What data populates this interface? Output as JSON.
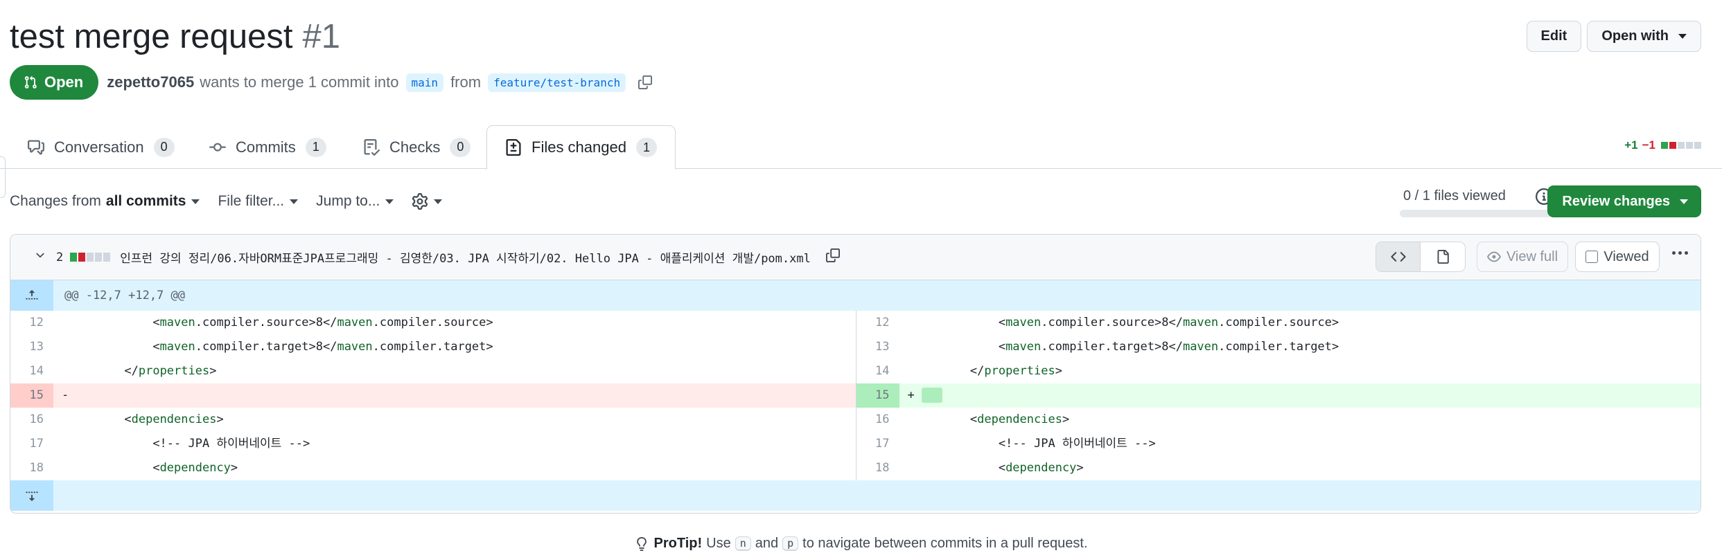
{
  "pr": {
    "title": "test merge request",
    "number": "#1",
    "state": "Open",
    "author": "zepetto7065",
    "merge_text": "wants to merge 1 commit into",
    "base_branch": "main",
    "from_text": "from",
    "head_branch": "feature/test-branch"
  },
  "header_actions": {
    "edit": "Edit",
    "open_with": "Open with"
  },
  "tabs": [
    {
      "label": "Conversation",
      "count": "0",
      "icon": "comment-discussion-icon"
    },
    {
      "label": "Commits",
      "count": "1",
      "icon": "git-commit-icon"
    },
    {
      "label": "Checks",
      "count": "0",
      "icon": "checklist-icon"
    },
    {
      "label": "Files changed",
      "count": "1",
      "icon": "file-diff-icon",
      "active": true
    }
  ],
  "diffstat": {
    "additions": "+1",
    "deletions": "−1"
  },
  "toolbar": {
    "changes_from": "Changes from",
    "changes_from_value": "all commits",
    "file_filter": "File filter...",
    "jump_to": "Jump to...",
    "files_viewed": "0 / 1 files viewed",
    "files_viewed_progress": 0,
    "review_changes": "Review changes"
  },
  "file": {
    "change_count": "2",
    "path": "인프런 강의 정리/06.자바ORM표준JPA프로그래밍 - 김영한/03. JPA 시작하기/02. Hello JPA - 애플리케이션 개발/pom.xml",
    "view_full": "View full",
    "viewed_label": "Viewed",
    "hunk_header": "@@ -12,7 +12,7 @@",
    "rows": [
      {
        "l_num": "12",
        "l_indent": "        ",
        "l_pre": "<",
        "l_tag": "maven",
        "l_post": ".compiler.source>8</",
        "l_tag2": "maven",
        "l_post2": ".compiler.source>",
        "r_num": "12",
        "r_indent": "        ",
        "r_pre": "<",
        "r_tag": "maven",
        "r_post": ".compiler.source>8</",
        "r_tag2": "maven",
        "r_post2": ".compiler.source>"
      },
      {
        "l_num": "13",
        "l_indent": "        ",
        "l_pre": "<",
        "l_tag": "maven",
        "l_post": ".compiler.target>8</",
        "l_tag2": "maven",
        "l_post2": ".compiler.target>",
        "r_num": "13",
        "r_indent": "        ",
        "r_pre": "<",
        "r_tag": "maven",
        "r_post": ".compiler.target>8</",
        "r_tag2": "maven",
        "r_post2": ".compiler.target>"
      },
      {
        "l_num": "14",
        "l_indent": "    ",
        "l_pre": "</",
        "l_tag": "properties",
        "l_post": ">",
        "l_tag2": "",
        "l_post2": "",
        "r_num": "14",
        "r_indent": "    ",
        "r_pre": "</",
        "r_tag": "properties",
        "r_post": ">",
        "r_tag2": "",
        "r_post2": ""
      },
      {
        "l_num": "15",
        "l_marker": "-",
        "r_num": "15",
        "r_marker": "+",
        "kind": "change"
      },
      {
        "l_num": "16",
        "l_indent": "    ",
        "l_pre": "<",
        "l_tag": "dependencies",
        "l_post": ">",
        "l_tag2": "",
        "l_post2": "",
        "r_num": "16",
        "r_indent": "    ",
        "r_pre": "<",
        "r_tag": "dependencies",
        "r_post": ">",
        "r_tag2": "",
        "r_post2": ""
      },
      {
        "l_num": "17",
        "l_indent": "        ",
        "l_pre": "<!-- JPA 하이버네이트 -->",
        "l_tag": "",
        "l_post": "",
        "l_tag2": "",
        "l_post2": "",
        "r_num": "17",
        "r_indent": "        ",
        "r_pre": "<!-- JPA 하이버네이트 -->",
        "r_tag": "",
        "r_post": "",
        "r_tag2": "",
        "r_post2": ""
      },
      {
        "l_num": "18",
        "l_indent": "        ",
        "l_pre": "<",
        "l_tag": "dependency",
        "l_post": ">",
        "l_tag2": "",
        "l_post2": "",
        "r_num": "18",
        "r_indent": "        ",
        "r_pre": "<",
        "r_tag": "dependency",
        "r_post": ">",
        "r_tag2": "",
        "r_post2": ""
      }
    ]
  },
  "protip": {
    "label": "ProTip!",
    "text1": "Use",
    "key1": "n",
    "text2": "and",
    "key2": "p",
    "text3": "to navigate between commits in a pull request."
  },
  "colors": {
    "open_green": "#1f883d",
    "link_blue": "#0969da",
    "deletion_bg": "#ffebe9",
    "addition_bg": "#e6ffec",
    "hunk_bg": "#ddf4ff"
  }
}
